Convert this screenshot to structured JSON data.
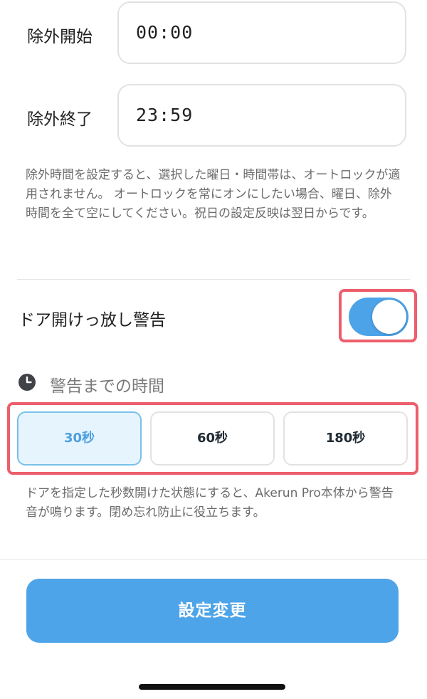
{
  "exclusion": {
    "start": {
      "label": "除外開始",
      "value": "00:00"
    },
    "end": {
      "label": "除外終了",
      "value": "23:59"
    },
    "note": "除外時間を設定すると、選択した曜日・時間帯は、オートロックが適用されません。 オートロックを常にオンにしたい場合、曜日、除外時間を全て空にしてください。祝日の設定反映は翌日からです。"
  },
  "door_open_warning": {
    "label": "ドア開けっ放し警告",
    "toggle_on": true,
    "toggle_color": "#4da3e8"
  },
  "warning_time": {
    "icon": "clock-icon",
    "title": "警告までの時間",
    "options": [
      "30秒",
      "60秒",
      "180秒"
    ],
    "selected": "30秒",
    "note": "ドアを指定した秒数開けた状態にすると、Akerun Pro本体から警告音が鳴ります。閉め忘れ防止に役立ちます。"
  },
  "submit": {
    "label": "設定変更",
    "color": "#4ea4e8"
  },
  "highlight_color": "#ec5f6c"
}
